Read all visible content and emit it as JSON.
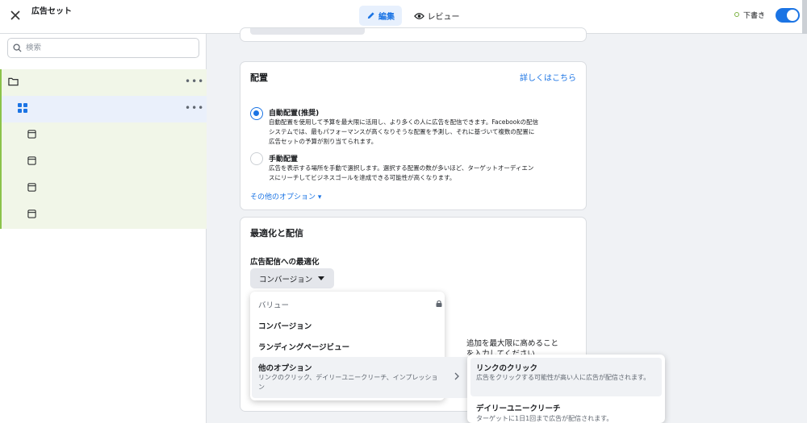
{
  "header": {
    "title": "広告セット",
    "close_icon": "close-icon",
    "tabs": [
      {
        "label": "編集",
        "icon": "pencil-icon",
        "active": true
      },
      {
        "label": "レビュー",
        "icon": "eye-icon",
        "active": false
      }
    ],
    "status_label": "下書き",
    "toggle_on": true
  },
  "sidebar": {
    "search_placeholder": "検索",
    "tree": [
      {
        "icon": "folder-icon",
        "level": 0
      },
      {
        "icon": "grid-icon",
        "level": 1,
        "selected": true
      },
      {
        "icon": "ad-icon",
        "level": 2
      },
      {
        "icon": "ad-icon",
        "level": 2
      },
      {
        "icon": "ad-icon",
        "level": 2
      },
      {
        "icon": "ad-icon",
        "level": 2
      }
    ]
  },
  "placement": {
    "title": "配置",
    "learn_more": "詳しくはこちら",
    "auto": {
      "title": "自動配置(推奨)",
      "desc_1": "自動配置を使用して予算を最大限に活用し、より多くの人に広告を配信できます。Facebookの配信",
      "desc_2": "システムでは、最もパフォーマンスが高くなりそうな配置を予測し、それに基づいて複数の配置に",
      "desc_3": "広告セットの予算が割り当てられます。"
    },
    "manual": {
      "title": "手動配置",
      "desc_1": "広告を表示する場所を手動で選択します。選択する配置の数が多いほど、ターゲットオーディエン",
      "desc_2": "スにリーチしてビジネスゴールを達成できる可能性が高くなります。"
    },
    "more_options": "その他のオプション ▾"
  },
  "optimization": {
    "title": "最適化と配信",
    "sub_label": "広告配信への最適化",
    "selected": "コンバージョン",
    "bg_text_1": "追加を最大限に高めること",
    "bg_text_2": "を入力してください"
  },
  "dropdown": {
    "header": "バリュー",
    "items": [
      "コンバージョン",
      "ランディングページビュー"
    ],
    "other": {
      "title": "他のオプション",
      "desc": "リンクのクリック、デイリーユニークリーチ、インプレッション"
    }
  },
  "submenu": {
    "items": [
      {
        "title": "リンクのクリック",
        "desc": "広告をクリックする可能性が高い人に広告が配信されます。"
      },
      {
        "title": "デイリーユニークリーチ",
        "desc": "ターゲットに1日1回まで広告が配信されます。"
      }
    ]
  },
  "colors": {
    "accent": "#1b74e4",
    "draft": "#7cb342",
    "tree_bg": "#f1f6e8"
  }
}
